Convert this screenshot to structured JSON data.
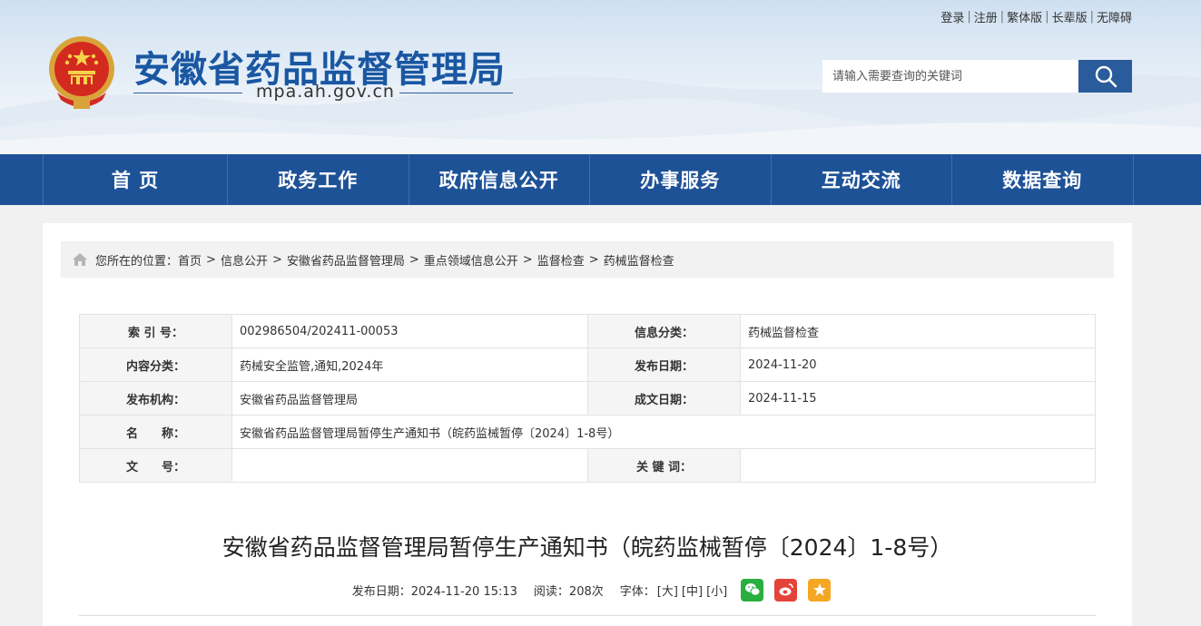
{
  "toplinks": [
    "登录",
    "注册",
    "繁体版",
    "长辈版",
    "无障碍"
  ],
  "site": {
    "title": "安徽省药品监督管理局",
    "domain": "mpa.ah.gov.cn"
  },
  "search": {
    "placeholder": "请输入需要查询的关键词"
  },
  "nav": [
    "首 页",
    "政务工作",
    "政府信息公开",
    "办事服务",
    "互动交流",
    "数据查询"
  ],
  "breadcrumb": {
    "prefix": "您所在的位置：",
    "items": [
      "首页",
      "信息公开",
      "安徽省药品监督管理局",
      "重点领域信息公开",
      "监督检查",
      "药械监督检查"
    ],
    "sep": ">"
  },
  "meta": {
    "index_label": "索 引 号：",
    "index_value": "002986504/202411-00053",
    "category_label": "信息分类：",
    "category_value": "药械监督检查",
    "content_label": "内容分类：",
    "content_value": "药械安全监管,通知,2024年",
    "pubdate_label": "发布日期：",
    "pubdate_value": "2024-11-20",
    "org_label": "发布机构：",
    "org_value": "安徽省药品监督管理局",
    "createdate_label": "成文日期：",
    "createdate_value": "2024-11-15",
    "name_label": "名　　称：",
    "name_value": "安徽省药品监督管理局暂停生产通知书（皖药监械暂停〔2024〕1-8号）",
    "docno_label": "文　　号：",
    "docno_value": "",
    "keywords_label": "关 键 词：",
    "keywords_value": ""
  },
  "article": {
    "title": "安徽省药品监督管理局暂停生产通知书（皖药监械暂停〔2024〕1-8号）",
    "pubdate": "发布日期：2024-11-20 15:13",
    "reads": "阅读：208次",
    "font_label": "字体：",
    "font_large": "[大]",
    "font_medium": "[中]",
    "font_small": "[小]"
  },
  "colors": {
    "nav_bg": "#1e5297",
    "title_blue": "#1a57a2",
    "search_btn": "#2a5b9a"
  }
}
